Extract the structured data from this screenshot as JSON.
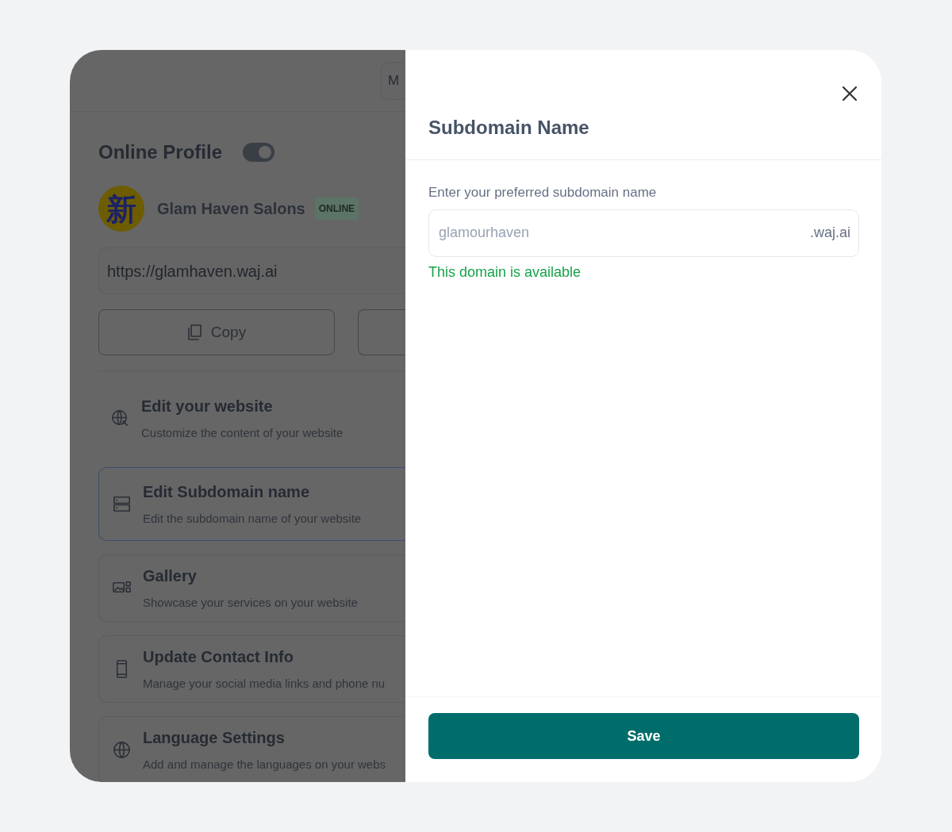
{
  "background": {
    "top_button": {
      "label": "M"
    },
    "profile": {
      "title": "Online Profile",
      "online_toggle": {
        "on": true
      },
      "avatar_text": "新",
      "name": "Glam Haven Salons",
      "status_badge": "ONLINE",
      "url": "https://glamhaven.waj.ai"
    },
    "buttons": [
      {
        "kind": "copy",
        "label": "Copy"
      },
      {
        "kind": "blank"
      }
    ],
    "menu_items": [
      {
        "kind": "plain",
        "selected": false,
        "title": "Edit your website",
        "subtitle": "Customize the content of your website"
      },
      {
        "kind": "card",
        "selected": true,
        "title": "Edit Subdomain name",
        "subtitle": "Edit the subdomain name of your website"
      },
      {
        "kind": "card",
        "selected": false,
        "title": "Gallery",
        "subtitle": "Showcase your services on your website"
      },
      {
        "kind": "card",
        "selected": false,
        "title": "Update Contact Info",
        "subtitle": "Manage your social media links and phone nu"
      },
      {
        "kind": "card",
        "selected": false,
        "title": "Language Settings",
        "subtitle": "Add and manage the languages on your webs"
      }
    ]
  },
  "modal": {
    "title": "Subdomain Name",
    "field_label": "Enter your preferred subdomain name",
    "subdomain_field": {
      "placeholder": "glamourhaven",
      "suffix": ".waj.ai"
    },
    "message": "This domain is available",
    "save_button": "Save"
  }
}
